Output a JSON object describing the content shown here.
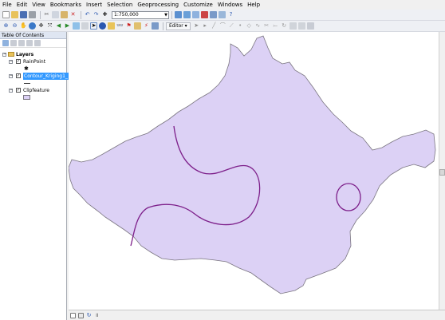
{
  "menu": [
    "File",
    "Edit",
    "View",
    "Bookmarks",
    "Insert",
    "Selection",
    "Geoprocessing",
    "Customize",
    "Windows",
    "Help"
  ],
  "toolbar": {
    "scale": "1:750,000",
    "editor_label": "Editor"
  },
  "toc": {
    "title": "Table Of Contents",
    "root_label": "Layers",
    "layers": [
      {
        "label": "RainPoint",
        "checked": true,
        "symbol": "point"
      },
      {
        "label": "Contour_Kriging1_",
        "checked": true,
        "selected": true,
        "symbol": "line"
      },
      {
        "label": "Clipfeature",
        "checked": true,
        "symbol": "fill"
      }
    ]
  },
  "colors": {
    "polygon_fill": "#dcd1f5",
    "polygon_stroke": "#7a7580",
    "contour": "#7d1f8a",
    "selection": "#3399ff"
  },
  "icons": {
    "new": "document-icon",
    "open": "folder-icon",
    "save": "save-icon",
    "print": "print-icon",
    "cut": "cut-icon",
    "copy": "copy-icon",
    "paste": "paste-icon",
    "delete": "delete-icon",
    "undo": "undo-icon",
    "redo": "redo-icon",
    "add_data": "add-data-icon",
    "zoom_in": "zoom-in-icon",
    "zoom_out": "zoom-out-icon",
    "pan": "pan-icon",
    "full_extent": "globe-icon",
    "select": "arrow-select-icon",
    "identify": "identify-icon",
    "find": "binoculars-icon",
    "measure": "ruler-icon"
  }
}
